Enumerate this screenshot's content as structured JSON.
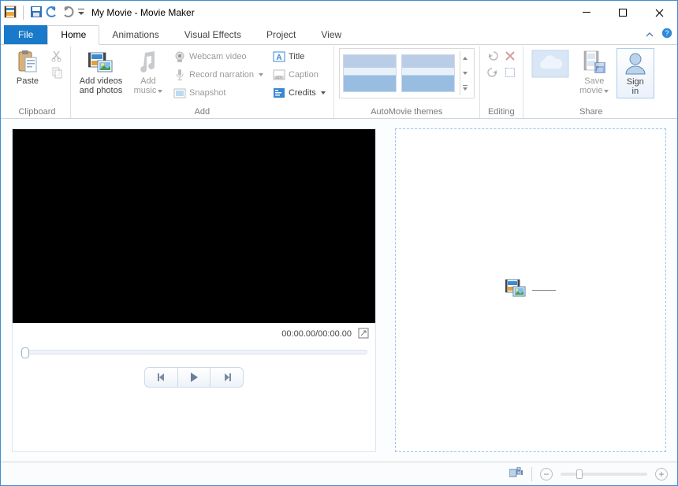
{
  "window": {
    "title": "My Movie - Movie Maker"
  },
  "tabs": {
    "file": "File",
    "home": "Home",
    "animations": "Animations",
    "visual_effects": "Visual Effects",
    "project": "Project",
    "view": "View"
  },
  "ribbon": {
    "clipboard": {
      "label": "Clipboard",
      "paste": "Paste"
    },
    "add": {
      "label": "Add",
      "add_videos": "Add videos\nand photos",
      "add_music": "Add\nmusic",
      "webcam": "Webcam video",
      "record": "Record narration",
      "snapshot": "Snapshot",
      "title": "Title",
      "caption": "Caption",
      "credits": "Credits"
    },
    "automovie": {
      "label": "AutoMovie themes"
    },
    "editing": {
      "label": "Editing"
    },
    "share": {
      "label": "Share",
      "save_movie": "Save\nmovie",
      "sign_in": "Sign\nin"
    }
  },
  "preview": {
    "timecode": "00:00.00/00:00.00"
  }
}
